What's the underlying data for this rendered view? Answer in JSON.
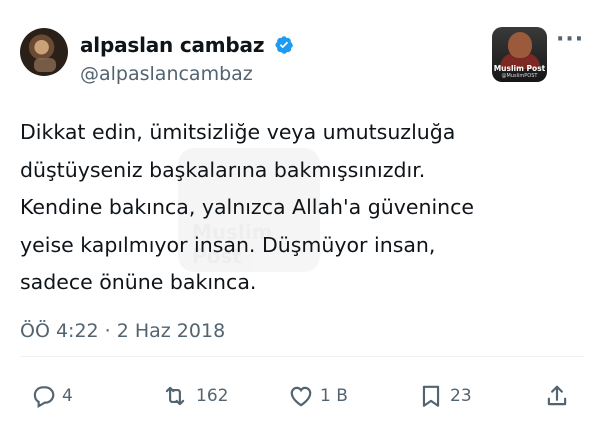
{
  "author": {
    "display_name": "alpaslan cambaz",
    "handle": "@alpaslancambaz",
    "verified": true
  },
  "badge": {
    "label": "Muslim Post",
    "handle": "@MuslimPOST"
  },
  "watermark": {
    "text": "Muslim Post"
  },
  "body_lines": [
    "Dikkat edin, ümitsizliğe veya umutsuzluğa",
    "düştüyseniz başkalarına bakmışsınızdır.",
    "Kendine bakınca, yalnızca Allah'a güvenince",
    "yeise kapılmıyor insan. Düşmüyor insan,",
    "sadece önüne bakınca."
  ],
  "meta": {
    "timestamp": "ÖÖ 4:22 · 2 Haz 2018"
  },
  "actions": {
    "replies": "4",
    "reposts": "162",
    "likes": "1 B",
    "bookmarks": "23"
  },
  "colors": {
    "text": "#0f1419",
    "secondary": "#536471",
    "verified": "#1d9bf0",
    "divider": "#eff3f4"
  },
  "icons": [
    "verified-icon",
    "more-icon",
    "reply-icon",
    "repost-icon",
    "like-icon",
    "bookmark-icon",
    "share-icon"
  ]
}
